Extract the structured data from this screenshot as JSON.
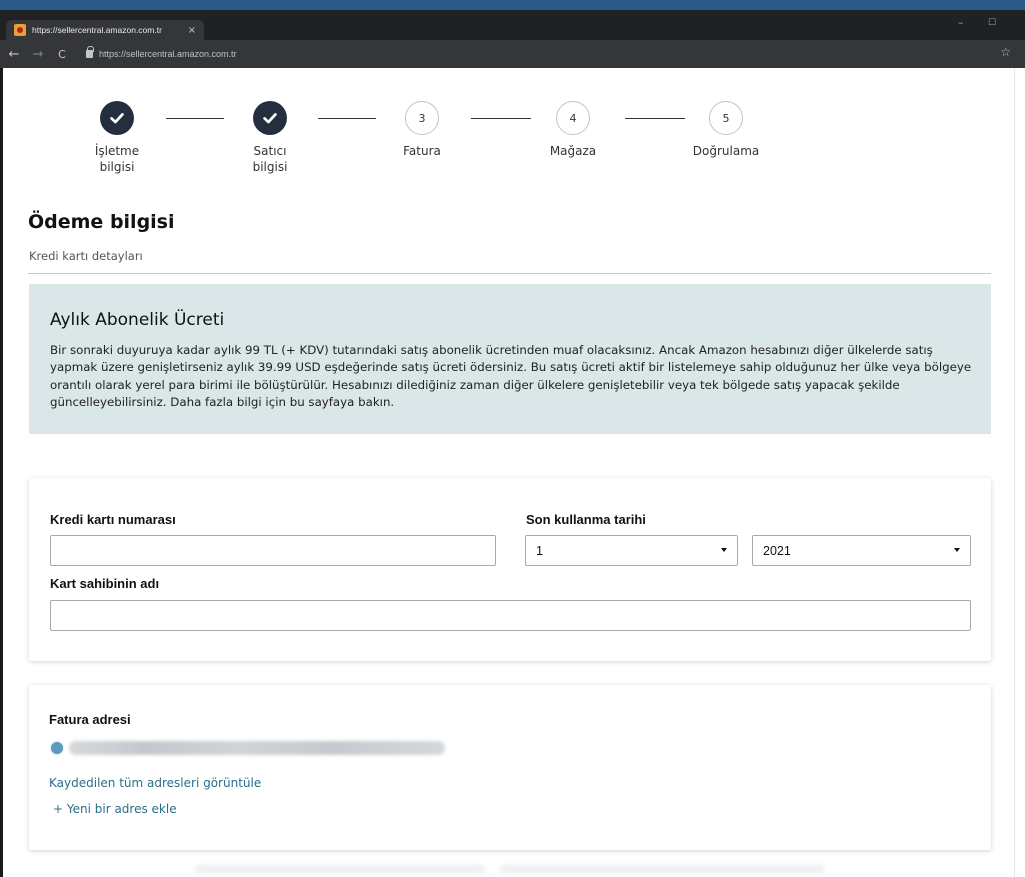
{
  "browser": {
    "tab_title": "https://sellercentral.amazon.com.tr",
    "tab_close": "×",
    "url": "https://sellercentral.amazon.com.tr",
    "controls": {
      "minimize": "–",
      "maximize": "☐"
    },
    "nav": {
      "back": "←",
      "forward": "→",
      "reload": "C"
    },
    "star": "☆"
  },
  "stepper": {
    "steps": [
      {
        "label": "İşletme bilgisi",
        "line1": "İşletme",
        "line2": "bilgisi",
        "status": "done"
      },
      {
        "label": "Satıcı bilgisi",
        "line1": "Satıcı",
        "line2": "bilgisi",
        "status": "done"
      },
      {
        "number": "3",
        "label": "Fatura",
        "status": "pending"
      },
      {
        "number": "4",
        "label": "Mağaza",
        "status": "pending"
      },
      {
        "number": "5",
        "label": "Doğrulama",
        "status": "pending"
      }
    ]
  },
  "section": {
    "title": "Ödeme bilgisi",
    "subtitle": "Kredi kartı detayları"
  },
  "info": {
    "title": "Aylık Abonelik Ücreti",
    "text": "Bir sonraki duyuruya kadar aylık 99 TL (+ KDV) tutarındaki satış abonelik ücretinden muaf olacaksınız. Ancak Amazon hesabınızı diğer ülkelerde satış yapmak üzere genişletirseniz aylık 39.99 USD eşdeğerinde satış ücreti ödersiniz. Bu satış ücreti aktif bir listelemeye sahip olduğunuz her ülke veya bölgeye orantılı olarak yerel para birimi ile bölüştürülür. Hesabınızı dilediğiniz zaman diğer ülkelere genişletebilir veya tek bölgede satış yapacak şekilde güncelleyebilirsiniz. Daha fazla bilgi için bu sayfaya bakın."
  },
  "card_form": {
    "card_number_label": "Kredi kartı numarası",
    "card_number_value": "",
    "expiry_label": "Son kullanma tarihi",
    "expiry_month": "1",
    "expiry_year": "2021",
    "holder_label": "Kart sahibinin adı",
    "holder_value": ""
  },
  "billing": {
    "label": "Fatura adresi",
    "view_all": "Kaydedilen tüm adresleri görüntüle",
    "add_new": "+ Yeni bir adres ekle"
  },
  "colors": {
    "stepper_done": "#232f3e",
    "info_bg": "#dbe6e8",
    "link": "#2a6f8a"
  }
}
